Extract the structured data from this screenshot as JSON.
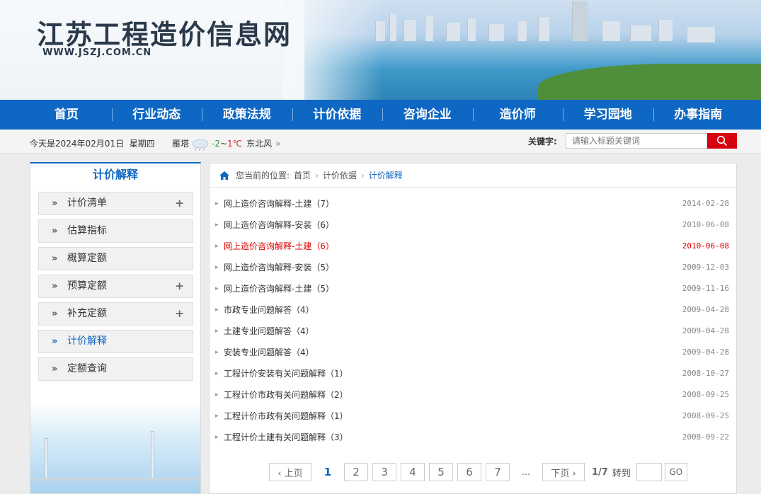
{
  "header": {
    "site_title": "江苏工程造价信息网",
    "domain": "WWW.JSZJ.COM.CN"
  },
  "nav": {
    "items": [
      "首页",
      "行业动态",
      "政策法规",
      "计价依据",
      "咨询企业",
      "造价师",
      "学习园地",
      "办事指南"
    ]
  },
  "infobar": {
    "date_text": "今天是2024年02月01日  星期四",
    "city": "雁塔",
    "temp_low": "-2",
    "temp_sep": "~",
    "temp_high": "1℃",
    "wind": "东北风",
    "more": "»",
    "keyword_label": "关键字:",
    "search_placeholder": "请输入标题关键词",
    "weather_icon": "snow-cloud-icon",
    "search_icon": "magnifier-icon"
  },
  "sidebar": {
    "title": "计价解释",
    "items": [
      {
        "label": "计价清单",
        "has_plus": true
      },
      {
        "label": "估算指标",
        "has_plus": false
      },
      {
        "label": "概算定额",
        "has_plus": false
      },
      {
        "label": "预算定额",
        "has_plus": true
      },
      {
        "label": "补充定额",
        "has_plus": true
      },
      {
        "label": "计价解释",
        "has_plus": false,
        "active": true
      },
      {
        "label": "定额查询",
        "has_plus": false
      }
    ],
    "arrow_glyph": "»",
    "plus_glyph": "+"
  },
  "breadcrumb": {
    "prefix": "您当前的位置:",
    "items": [
      "首页",
      "计价依据",
      "计价解释"
    ],
    "separator": "›"
  },
  "articles": [
    {
      "title": "网上造价咨询解释-土建（7）",
      "date": "2014-02-28",
      "highlight": false
    },
    {
      "title": "网上造价咨询解释-安装（6）",
      "date": "2010-06-08",
      "highlight": false
    },
    {
      "title": "网上造价咨询解释-土建（6）",
      "date": "2010-06-08",
      "highlight": true
    },
    {
      "title": "网上造价咨询解释-安装（5）",
      "date": "2009-12-03",
      "highlight": false
    },
    {
      "title": "网上造价咨询解释-土建（5）",
      "date": "2009-11-16",
      "highlight": false
    },
    {
      "title": "市政专业问题解答（4）",
      "date": "2009-04-28",
      "highlight": false
    },
    {
      "title": "土建专业问题解答（4）",
      "date": "2009-04-28",
      "highlight": false
    },
    {
      "title": "安装专业问题解答（4）",
      "date": "2009-04-28",
      "highlight": false
    },
    {
      "title": "工程计价安装有关问题解释（1）",
      "date": "2008-10-27",
      "highlight": false
    },
    {
      "title": "工程计价市政有关问题解释（2）",
      "date": "2008-09-25",
      "highlight": false
    },
    {
      "title": "工程计价市政有关问题解释（1）",
      "date": "2008-09-25",
      "highlight": false
    },
    {
      "title": "工程计价土建有关问题解释（3）",
      "date": "2008-09-22",
      "highlight": false
    }
  ],
  "pager": {
    "prev": "‹ 上页",
    "current": "1",
    "pages": [
      "2",
      "3",
      "4",
      "5",
      "6",
      "7"
    ],
    "ellipsis": "...",
    "next": "下页 ›",
    "total": "1/7",
    "goto_label": "转到",
    "go": "GO"
  },
  "colors": {
    "nav_blue": "#0e67c3",
    "search_red": "#d7000f",
    "highlight_red": "#dd0000"
  }
}
